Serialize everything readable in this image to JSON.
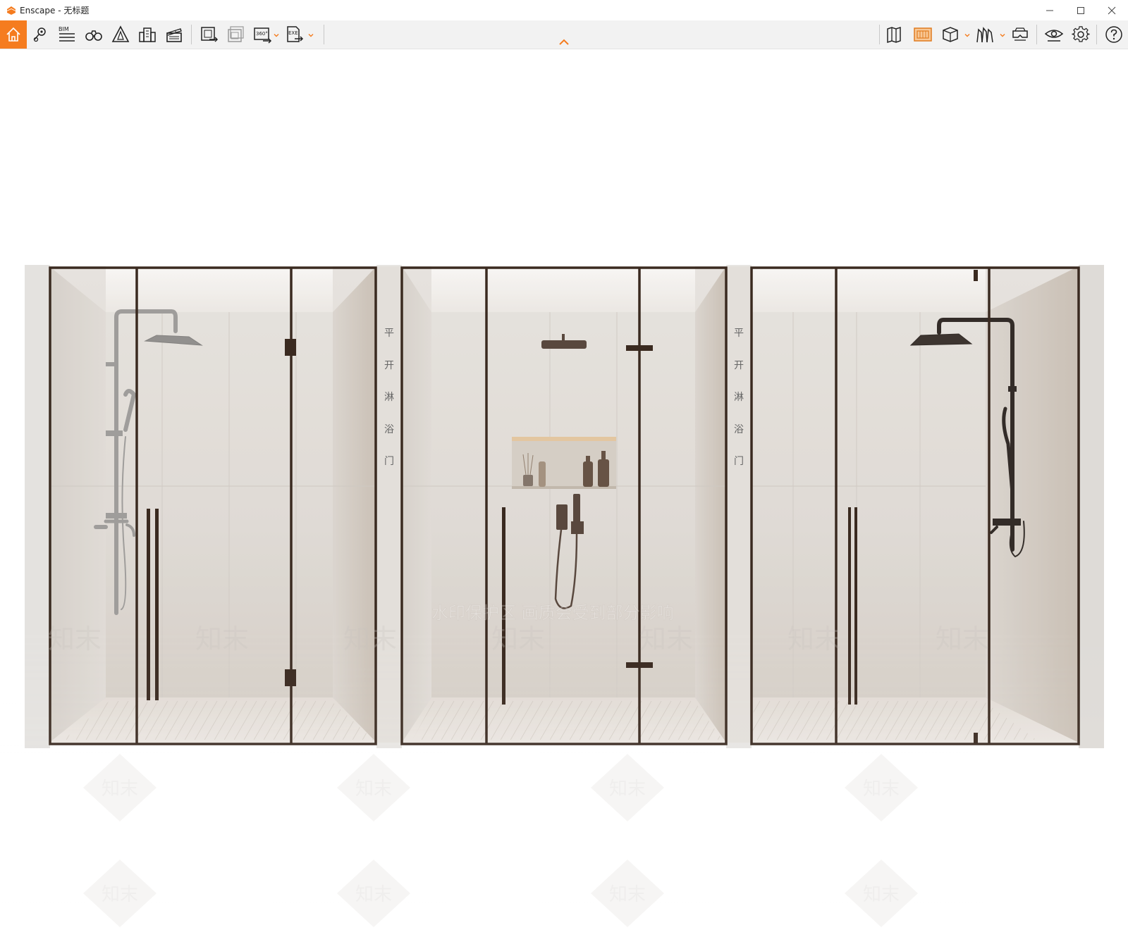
{
  "window": {
    "title": "Enscape - 无标题",
    "minimize_icon": "minimize-icon",
    "maximize_icon": "maximize-icon",
    "close_icon": "close-icon"
  },
  "toolbar": {
    "accent": "#f57c1f",
    "left_tools": [
      {
        "name": "home-icon",
        "active": true
      },
      {
        "name": "map-pin-icon"
      },
      {
        "name": "bim-icon",
        "label": "BIM"
      },
      {
        "name": "binoculars-icon"
      },
      {
        "name": "warning-triangle-icon"
      },
      {
        "name": "buildings-icon"
      },
      {
        "name": "clapperboard-icon"
      },
      {
        "name": "render-image-icon"
      },
      {
        "name": "batch-render-icon"
      },
      {
        "name": "panorama-360-icon",
        "label": "360°"
      },
      {
        "name": "export-exe-icon",
        "label": "EXE"
      }
    ],
    "right_tools": [
      {
        "name": "map-book-icon"
      },
      {
        "name": "asset-library-icon",
        "active": true
      },
      {
        "name": "cube-view-icon"
      },
      {
        "name": "people-icon"
      },
      {
        "name": "vr-headset-icon"
      },
      {
        "name": "visual-settings-eye-icon"
      },
      {
        "name": "settings-gear-icon"
      },
      {
        "name": "help-icon"
      }
    ],
    "collapse_icon": "chevron-up-icon"
  },
  "viewport": {
    "side_labels": [
      [
        "平",
        "开",
        "淋",
        "浴",
        "门"
      ],
      [
        "平",
        "开",
        "淋",
        "浴",
        "门"
      ]
    ],
    "watermarks": {
      "banner": "水印保护区  画质会受到部分影响",
      "mark": "知末"
    },
    "frame_color": "#3a2a20"
  }
}
